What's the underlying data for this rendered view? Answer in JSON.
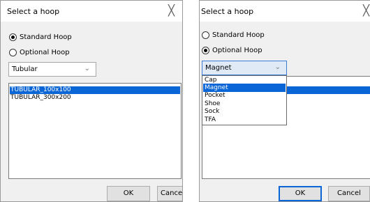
{
  "left_dialog": {
    "title": "Select a hoop",
    "close_glyph": "╳",
    "radio_standard_label": "Standard Hoop",
    "radio_optional_label": "Optional Hoop",
    "selected_radio": "standard",
    "combo_value": "Tubular",
    "list_items": [
      "TUBULAR_100x100",
      "TUBULAR_300x200"
    ],
    "selected_item": "TUBULAR_100x100",
    "ok_label": "OK",
    "cancel_label": "Cancel"
  },
  "right_dialog": {
    "title": "Select a hoop",
    "close_glyph": "╳",
    "radio_standard_label": "Standard Hoop",
    "radio_optional_label": "Optional Hoop",
    "selected_radio": "optional",
    "combo_value": "Magnet",
    "dropdown_options": [
      "Cap",
      "Magnet",
      "Pocket",
      "Shoe",
      "Sock",
      "TFA"
    ],
    "selected_option": "Magnet",
    "ok_label": "OK",
    "cancel_label": "Cancel"
  },
  "icons": {
    "chevron": "chevron-down-icon",
    "close": "close-icon",
    "radio": "radio-button"
  },
  "colors": {
    "selection": "#0a66d6",
    "dialog_bg": "#f0f0f0",
    "focus_border": "#0a66d6"
  }
}
